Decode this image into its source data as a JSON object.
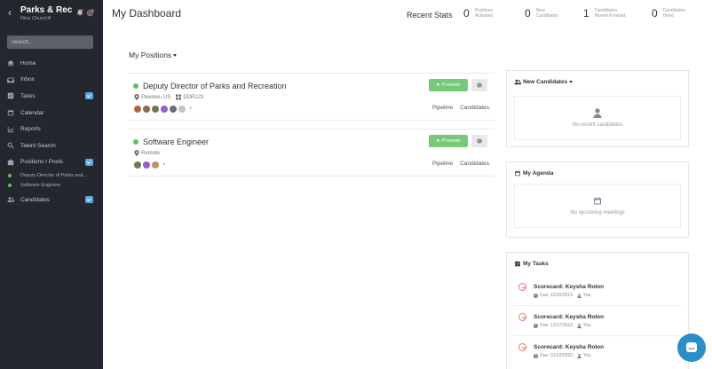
{
  "app": {
    "title": "Parks & Rec",
    "user": "Nina Churchill"
  },
  "search": {
    "placeholder": "Search..."
  },
  "nav": {
    "home": "Home",
    "inbox": "Inbox",
    "tasks": "Tasks",
    "calendar": "Calendar",
    "reports": "Reports",
    "talent_search": "Talent Search",
    "positions": "Positions / Pools",
    "position_1": "Deputy Director of Parks and...",
    "position_2": "Software Engineer",
    "candidates": "Candidates"
  },
  "header": {
    "title": "My Dashboard",
    "recent_stats": "Recent Stats",
    "stats": [
      {
        "value": "0",
        "label_1": "Positions",
        "label_2": "Activated"
      },
      {
        "value": "0",
        "label_1": "New",
        "label_2": "Candidates"
      },
      {
        "value": "1",
        "label_1": "Candidates",
        "label_2": "Moved Forward"
      },
      {
        "value": "0",
        "label_1": "Candidates",
        "label_2": "Hired"
      }
    ]
  },
  "positions": {
    "header": "My Positions",
    "items": [
      {
        "title": "Deputy Director of Parks and Recreation",
        "location": "Pawnee, US",
        "code": "DDR123",
        "promote": "Promote",
        "pipeline": "Pipeline",
        "candidates": "Candidates",
        "more": "+"
      },
      {
        "title": "Software Engineer",
        "location": "Remote",
        "promote": "Promote",
        "pipeline": "Pipeline",
        "candidates": "Candidates",
        "more": "+"
      }
    ]
  },
  "widgets": {
    "new_candidates": {
      "title": "New Candidates",
      "empty": "No recent candidates"
    },
    "agenda": {
      "title": "My Agenda",
      "empty": "No upcoming meetings"
    },
    "tasks": {
      "title": "My Tasks",
      "items": [
        {
          "name": "Scorecard: Keysha Rolon",
          "due": "Due: 12/16/2019",
          "owner": "You"
        },
        {
          "name": "Scorecard: Keysha Rolon",
          "due": "Due: 12/17/2019",
          "owner": "You"
        },
        {
          "name": "Scorecard: Keysha Rolon",
          "due": "Due: 01/12/2020",
          "owner": "You"
        }
      ]
    }
  },
  "colors": {
    "sidebar": "#24282e",
    "accent_green": "#77c879",
    "status_dot": "#5cc25c",
    "badge_blue": "#5ba8de",
    "task_red": "#e27b74",
    "chat_blue": "#2b8ec8"
  }
}
